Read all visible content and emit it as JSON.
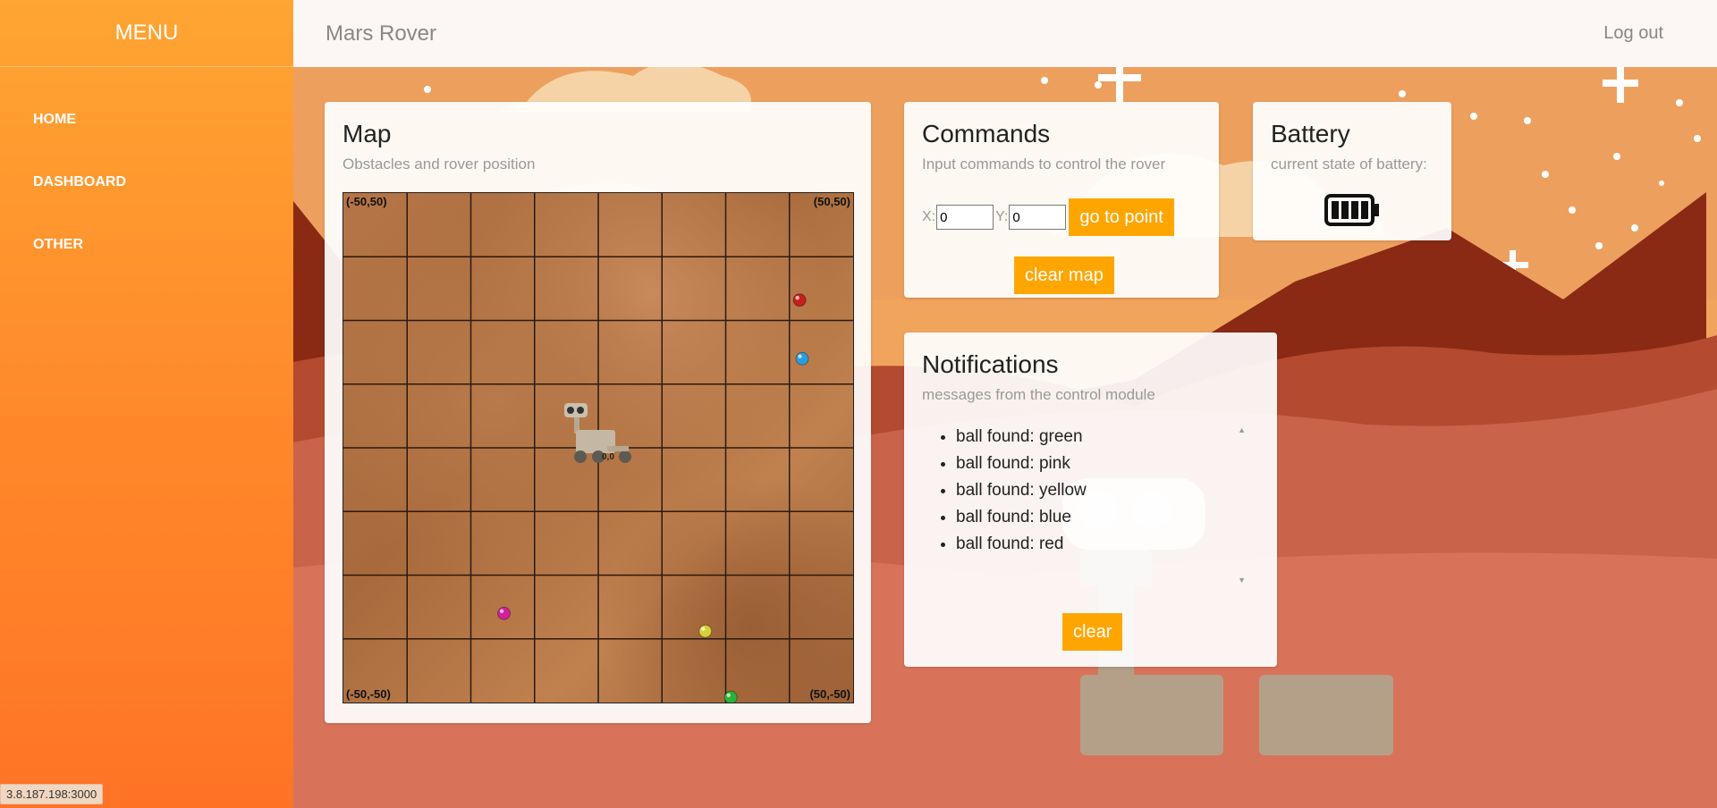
{
  "sidebar": {
    "title": "MENU",
    "items": [
      {
        "label": "HOME"
      },
      {
        "label": "DASHBOARD"
      },
      {
        "label": "OTHER"
      }
    ]
  },
  "topbar": {
    "title": "Mars Rover",
    "logout": "Log out"
  },
  "status_url": "3.8.187.198:3000",
  "map": {
    "title": "Map",
    "subtitle": "Obstacles and rover position",
    "corners": {
      "top_left": "(-50,50)",
      "top_right": "(50,50)",
      "bottom_left": "(-50,-50)",
      "bottom_right": "(50,-50)"
    },
    "range": [
      -50,
      50
    ],
    "grid_divisions": 8,
    "rover": {
      "x": 0,
      "y": 0,
      "label": "0,0"
    },
    "balls": [
      {
        "color_name": "red",
        "color": "#c81e1e",
        "x": 39.5,
        "y": 29
      },
      {
        "color_name": "blue",
        "color": "#2a9de0",
        "x": 40,
        "y": 17.5
      },
      {
        "color_name": "pink",
        "color": "#d0209a",
        "x": -18.5,
        "y": -32.5
      },
      {
        "color_name": "yellow",
        "color": "#d6cf3a",
        "x": 21,
        "y": -36
      },
      {
        "color_name": "green",
        "color": "#2ab43a",
        "x": 26,
        "y": -49
      }
    ]
  },
  "commands": {
    "title": "Commands",
    "subtitle": "Input commands to control the rover",
    "x_label": "X:",
    "y_label": "Y:",
    "x_value": "0",
    "y_value": "0",
    "goto_label": "go to point",
    "clear_map_label": "clear map"
  },
  "battery": {
    "title": "Battery",
    "subtitle": "current state of battery:",
    "level": 1.0,
    "icon": "battery-full-icon"
  },
  "notifications": {
    "title": "Notifications",
    "subtitle": "messages from the control module",
    "messages": [
      "ball found: green",
      "ball found: pink",
      "ball found: yellow",
      "ball found: blue",
      "ball found: red"
    ],
    "clear_label": "clear"
  }
}
